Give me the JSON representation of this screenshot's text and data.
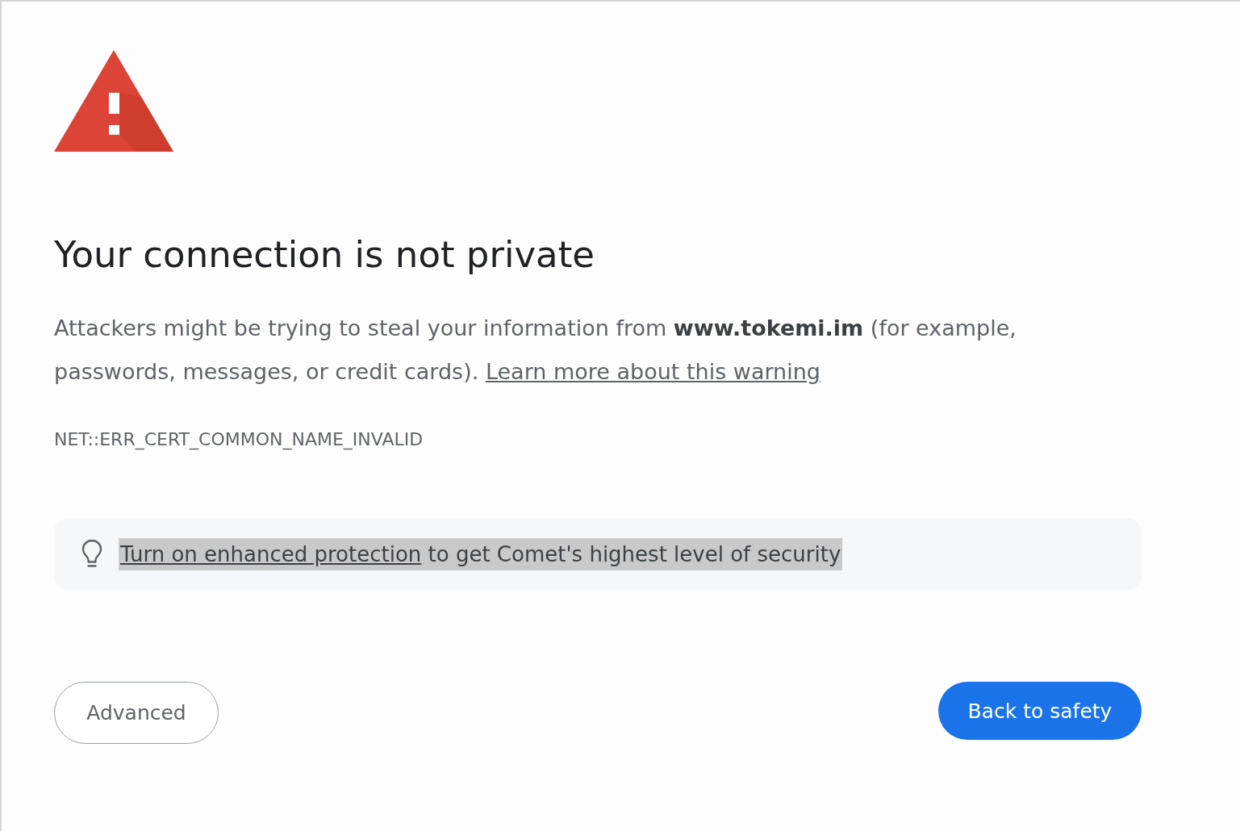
{
  "heading": "Your connection is not private",
  "message": {
    "text": "Attackers might be trying to steal your information from **www.tokemi.im** (for example, passwords, messages, or credit cards).",
    "link": "Learn more about this warning"
  },
  "error_code": "NET::ERR_CERT_COMMON_NAME_INVALID",
  "tip": {
    "link": "Turn on enhanced protection",
    "text": "to get Comet's highest level of security",
    "highlighted": true
  },
  "buttons": [
    {
      "label": "Advanced",
      "kind": "secondary"
    },
    {
      "label": "Back to safety",
      "kind": "primary"
    }
  ]
}
